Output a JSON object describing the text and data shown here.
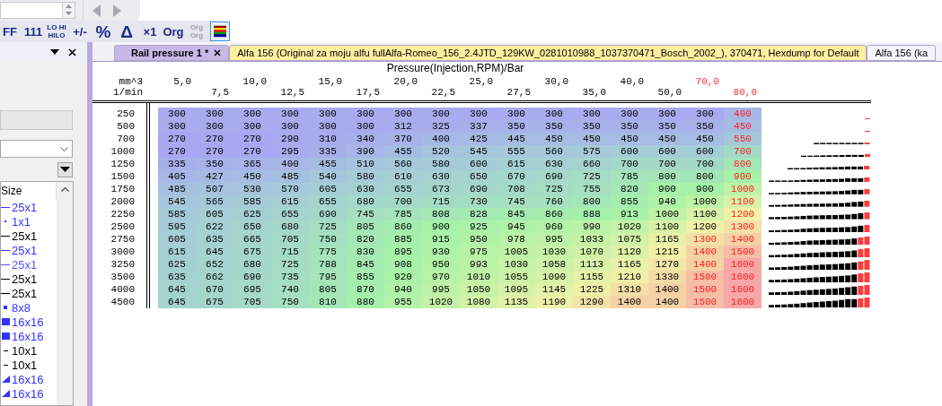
{
  "toolbar": {
    "buttons": [
      {
        "kind": "text",
        "label": "FF",
        "disabled": false,
        "selected": false
      },
      {
        "kind": "text",
        "label": "111",
        "disabled": false,
        "selected": false
      },
      {
        "kind": "stack",
        "label": "LO HI",
        "label2": "HILO",
        "disabled": false,
        "selected": false
      },
      {
        "kind": "text",
        "label": "+/-",
        "disabled": false,
        "selected": false
      },
      {
        "kind": "big",
        "label": "%",
        "disabled": false,
        "selected": false
      },
      {
        "kind": "big",
        "label": "Δ",
        "disabled": false,
        "selected": false
      },
      {
        "kind": "text",
        "label": "×1",
        "disabled": false,
        "selected": false
      },
      {
        "kind": "text",
        "label": "Org",
        "disabled": false,
        "selected": false
      },
      {
        "kind": "stack",
        "label": "Org",
        "label2": "Org",
        "disabled": true,
        "selected": false
      },
      {
        "kind": "colors",
        "disabled": false,
        "selected": true
      }
    ]
  },
  "left_panel": {
    "list": {
      "column": "Size",
      "items": [
        {
          "kind": "line",
          "size": "25x1",
          "color": "#3333ff"
        },
        {
          "kind": "dot",
          "size": "1x1",
          "color": "#3333ff"
        },
        {
          "kind": "line",
          "size": "25x1",
          "color": "#000000"
        },
        {
          "kind": "line",
          "size": "25x1",
          "color": "#3333ff"
        },
        {
          "kind": "line",
          "size": "25x1",
          "color": "#5555ff"
        },
        {
          "kind": "line",
          "size": "25x1",
          "color": "#000000"
        },
        {
          "kind": "line",
          "size": "25x1",
          "color": "#000000"
        },
        {
          "kind": "square",
          "size": "8x8",
          "color": "#3333ff"
        },
        {
          "kind": "block",
          "size": "16x16",
          "color": "#3333ff"
        },
        {
          "kind": "block",
          "size": "16x16",
          "color": "#3333ff"
        },
        {
          "kind": "short",
          "size": "10x1",
          "color": "#000000"
        },
        {
          "kind": "short",
          "size": "10x1",
          "color": "#000000"
        },
        {
          "kind": "wedge",
          "size": "16x16",
          "color": "#3333ff"
        },
        {
          "kind": "wedge",
          "size": "16x16",
          "color": "#3333ff"
        }
      ]
    }
  },
  "tabs": [
    {
      "label": "Rail pressure 1 *",
      "selected": true,
      "closable": true,
      "color": "#c8b8e8"
    },
    {
      "label": "Alfa 156 (Original za moju alfu fullAlfa-Romeo_156_2.4JTD_129KW_0281010988_1037370471_Bosch_2002_), 370471, Hexdump for Default",
      "selected": false,
      "closable": false,
      "color": "#fff0a0"
    },
    {
      "label": "Alfa 156 (ka",
      "selected": false,
      "closable": false,
      "color": "#f4f4ff"
    }
  ],
  "map": {
    "title": "Pressure(Injection,RPM)/Bar",
    "x_label": "mm^3",
    "y_label": "1/min",
    "columns": [
      {
        "text": "5,0",
        "flagged": false
      },
      {
        "text": "7,5",
        "flagged": false
      },
      {
        "text": "10,0",
        "flagged": false
      },
      {
        "text": "12,5",
        "flagged": false
      },
      {
        "text": "15,0",
        "flagged": false
      },
      {
        "text": "17,5",
        "flagged": false
      },
      {
        "text": "20,0",
        "flagged": false
      },
      {
        "text": "22,5",
        "flagged": false
      },
      {
        "text": "25,0",
        "flagged": false
      },
      {
        "text": "27,5",
        "flagged": false
      },
      {
        "text": "30,0",
        "flagged": false
      },
      {
        "text": "35,0",
        "flagged": false
      },
      {
        "text": "40,0",
        "flagged": false
      },
      {
        "text": "50,0",
        "flagged": false
      },
      {
        "text": "70,0",
        "flagged": true
      },
      {
        "text": "80,0",
        "flagged": true
      }
    ],
    "rows": [
      {
        "rpm": "250",
        "values": [
          "300",
          "300",
          "300",
          "300",
          "300",
          "300",
          "300",
          "300",
          "300",
          "300",
          "300",
          "300",
          "300",
          "300",
          "300",
          "400"
        ],
        "flagged": [
          false,
          false,
          false,
          false,
          false,
          false,
          false,
          false,
          false,
          false,
          false,
          false,
          false,
          false,
          false,
          true
        ]
      },
      {
        "rpm": "500",
        "values": [
          "300",
          "300",
          "300",
          "300",
          "300",
          "300",
          "312",
          "325",
          "337",
          "350",
          "350",
          "350",
          "350",
          "350",
          "350",
          "450"
        ],
        "flagged": [
          false,
          false,
          false,
          false,
          false,
          false,
          false,
          false,
          false,
          false,
          false,
          false,
          false,
          false,
          false,
          true
        ]
      },
      {
        "rpm": "700",
        "values": [
          "270",
          "270",
          "270",
          "290",
          "310",
          "340",
          "370",
          "400",
          "425",
          "445",
          "450",
          "450",
          "450",
          "450",
          "450",
          "550"
        ],
        "flagged": [
          false,
          false,
          false,
          false,
          false,
          false,
          false,
          false,
          false,
          false,
          false,
          false,
          false,
          false,
          false,
          true
        ]
      },
      {
        "rpm": "1000",
        "values": [
          "270",
          "270",
          "270",
          "295",
          "335",
          "390",
          "455",
          "520",
          "545",
          "555",
          "560",
          "575",
          "600",
          "600",
          "600",
          "700"
        ],
        "flagged": [
          false,
          false,
          false,
          false,
          false,
          false,
          false,
          false,
          false,
          false,
          false,
          false,
          false,
          false,
          false,
          true
        ]
      },
      {
        "rpm": "1250",
        "values": [
          "335",
          "350",
          "365",
          "400",
          "455",
          "510",
          "560",
          "580",
          "600",
          "615",
          "630",
          "660",
          "700",
          "700",
          "700",
          "800"
        ],
        "flagged": [
          false,
          false,
          false,
          false,
          false,
          false,
          false,
          false,
          false,
          false,
          false,
          false,
          false,
          false,
          false,
          true
        ]
      },
      {
        "rpm": "1500",
        "values": [
          "405",
          "427",
          "450",
          "485",
          "540",
          "580",
          "610",
          "630",
          "650",
          "670",
          "690",
          "725",
          "785",
          "800",
          "800",
          "900"
        ],
        "flagged": [
          false,
          false,
          false,
          false,
          false,
          false,
          false,
          false,
          false,
          false,
          false,
          false,
          false,
          false,
          false,
          true
        ]
      },
      {
        "rpm": "1750",
        "values": [
          "485",
          "507",
          "530",
          "570",
          "605",
          "630",
          "655",
          "673",
          "690",
          "708",
          "725",
          "755",
          "820",
          "900",
          "900",
          "1000"
        ],
        "flagged": [
          false,
          false,
          false,
          false,
          false,
          false,
          false,
          false,
          false,
          false,
          false,
          false,
          false,
          false,
          false,
          true
        ]
      },
      {
        "rpm": "2000",
        "values": [
          "545",
          "565",
          "585",
          "615",
          "655",
          "680",
          "700",
          "715",
          "730",
          "745",
          "760",
          "800",
          "855",
          "940",
          "1000",
          "1100"
        ],
        "flagged": [
          false,
          false,
          false,
          false,
          false,
          false,
          false,
          false,
          false,
          false,
          false,
          false,
          false,
          false,
          false,
          true
        ]
      },
      {
        "rpm": "2250",
        "values": [
          "585",
          "605",
          "625",
          "655",
          "690",
          "745",
          "785",
          "808",
          "828",
          "845",
          "860",
          "888",
          "913",
          "1000",
          "1100",
          "1200"
        ],
        "flagged": [
          false,
          false,
          false,
          false,
          false,
          false,
          false,
          false,
          false,
          false,
          false,
          false,
          false,
          false,
          false,
          true
        ]
      },
      {
        "rpm": "2500",
        "values": [
          "595",
          "622",
          "650",
          "680",
          "725",
          "805",
          "860",
          "900",
          "925",
          "945",
          "960",
          "990",
          "1020",
          "1100",
          "1200",
          "1300"
        ],
        "flagged": [
          false,
          false,
          false,
          false,
          false,
          false,
          false,
          false,
          false,
          false,
          false,
          false,
          false,
          false,
          false,
          true
        ]
      },
      {
        "rpm": "2750",
        "values": [
          "605",
          "635",
          "665",
          "705",
          "750",
          "820",
          "885",
          "915",
          "950",
          "978",
          "995",
          "1033",
          "1075",
          "1165",
          "1300",
          "1400"
        ],
        "flagged": [
          false,
          false,
          false,
          false,
          false,
          false,
          false,
          false,
          false,
          false,
          false,
          false,
          false,
          false,
          true,
          true
        ]
      },
      {
        "rpm": "3000",
        "values": [
          "615",
          "645",
          "675",
          "715",
          "775",
          "830",
          "895",
          "930",
          "975",
          "1005",
          "1030",
          "1070",
          "1120",
          "1215",
          "1400",
          "1500"
        ],
        "flagged": [
          false,
          false,
          false,
          false,
          false,
          false,
          false,
          false,
          false,
          false,
          false,
          false,
          false,
          false,
          true,
          true
        ]
      },
      {
        "rpm": "3250",
        "values": [
          "625",
          "652",
          "680",
          "725",
          "788",
          "845",
          "908",
          "950",
          "993",
          "1030",
          "1058",
          "1113",
          "1165",
          "1270",
          "1400",
          "1600"
        ],
        "flagged": [
          false,
          false,
          false,
          false,
          false,
          false,
          false,
          false,
          false,
          false,
          false,
          false,
          false,
          false,
          true,
          true
        ]
      },
      {
        "rpm": "3500",
        "values": [
          "635",
          "662",
          "690",
          "735",
          "795",
          "855",
          "920",
          "970",
          "1010",
          "1055",
          "1090",
          "1155",
          "1210",
          "1330",
          "1500",
          "1600"
        ],
        "flagged": [
          false,
          false,
          false,
          false,
          false,
          false,
          false,
          false,
          false,
          false,
          false,
          false,
          false,
          false,
          true,
          true
        ]
      },
      {
        "rpm": "4000",
        "values": [
          "645",
          "670",
          "695",
          "740",
          "805",
          "870",
          "940",
          "995",
          "1050",
          "1095",
          "1145",
          "1225",
          "1310",
          "1400",
          "1500",
          "1600"
        ],
        "flagged": [
          false,
          false,
          false,
          false,
          false,
          false,
          false,
          false,
          false,
          false,
          false,
          false,
          false,
          false,
          true,
          true
        ]
      },
      {
        "rpm": "4500",
        "values": [
          "645",
          "675",
          "705",
          "750",
          "810",
          "880",
          "955",
          "1020",
          "1080",
          "1135",
          "1190",
          "1290",
          "1400",
          "1400",
          "1500",
          "1600"
        ],
        "flagged": [
          false,
          false,
          false,
          false,
          false,
          false,
          false,
          false,
          false,
          false,
          false,
          false,
          false,
          false,
          true,
          true
        ]
      }
    ]
  }
}
